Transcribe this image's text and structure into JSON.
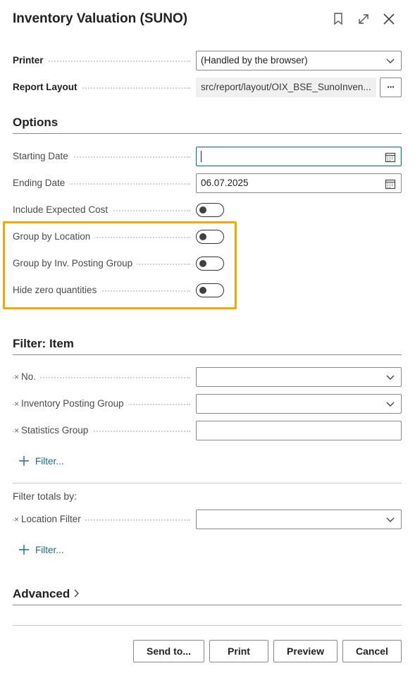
{
  "dialog": {
    "title": "Inventory Valuation (SUNO)"
  },
  "header_icons": [
    "bookmark-icon",
    "expand-icon",
    "close-icon"
  ],
  "general": {
    "printer": {
      "label": "Printer",
      "value": "(Handled by the browser)"
    },
    "report_layout": {
      "label": "Report Layout",
      "value": "src/report/layout/OIX_BSE_SunoInven...",
      "more_label": "···"
    }
  },
  "options": {
    "heading": "Options",
    "starting_date": {
      "label": "Starting Date",
      "value": ""
    },
    "ending_date": {
      "label": "Ending Date",
      "value": "06.07.2025"
    },
    "include_expected_cost": {
      "label": "Include Expected Cost",
      "on": false
    },
    "group_by_location": {
      "label": "Group by Location",
      "on": false
    },
    "group_by_inv_posting_group": {
      "label": "Group by Inv. Posting Group",
      "on": false
    },
    "hide_zero_quantities": {
      "label": "Hide zero quantities",
      "on": false
    }
  },
  "filter_item": {
    "heading": "Filter: Item",
    "remove_mark": "×",
    "fields": [
      {
        "label": "No.",
        "value": ""
      },
      {
        "label": "Inventory Posting Group",
        "value": ""
      },
      {
        "label": "Statistics Group",
        "value": ""
      }
    ],
    "add_filter_label": "Filter..."
  },
  "filter_totals": {
    "heading": "Filter totals by:",
    "fields": [
      {
        "label": "Location Filter",
        "value": ""
      }
    ],
    "add_filter_label": "Filter..."
  },
  "advanced": {
    "heading": "Advanced"
  },
  "buttons": {
    "send_to": "Send to...",
    "print": "Print",
    "preview": "Preview",
    "cancel": "Cancel"
  },
  "colors": {
    "highlight": "#f5a800",
    "link": "#1b6f80",
    "focus": "#1b7a8c"
  }
}
